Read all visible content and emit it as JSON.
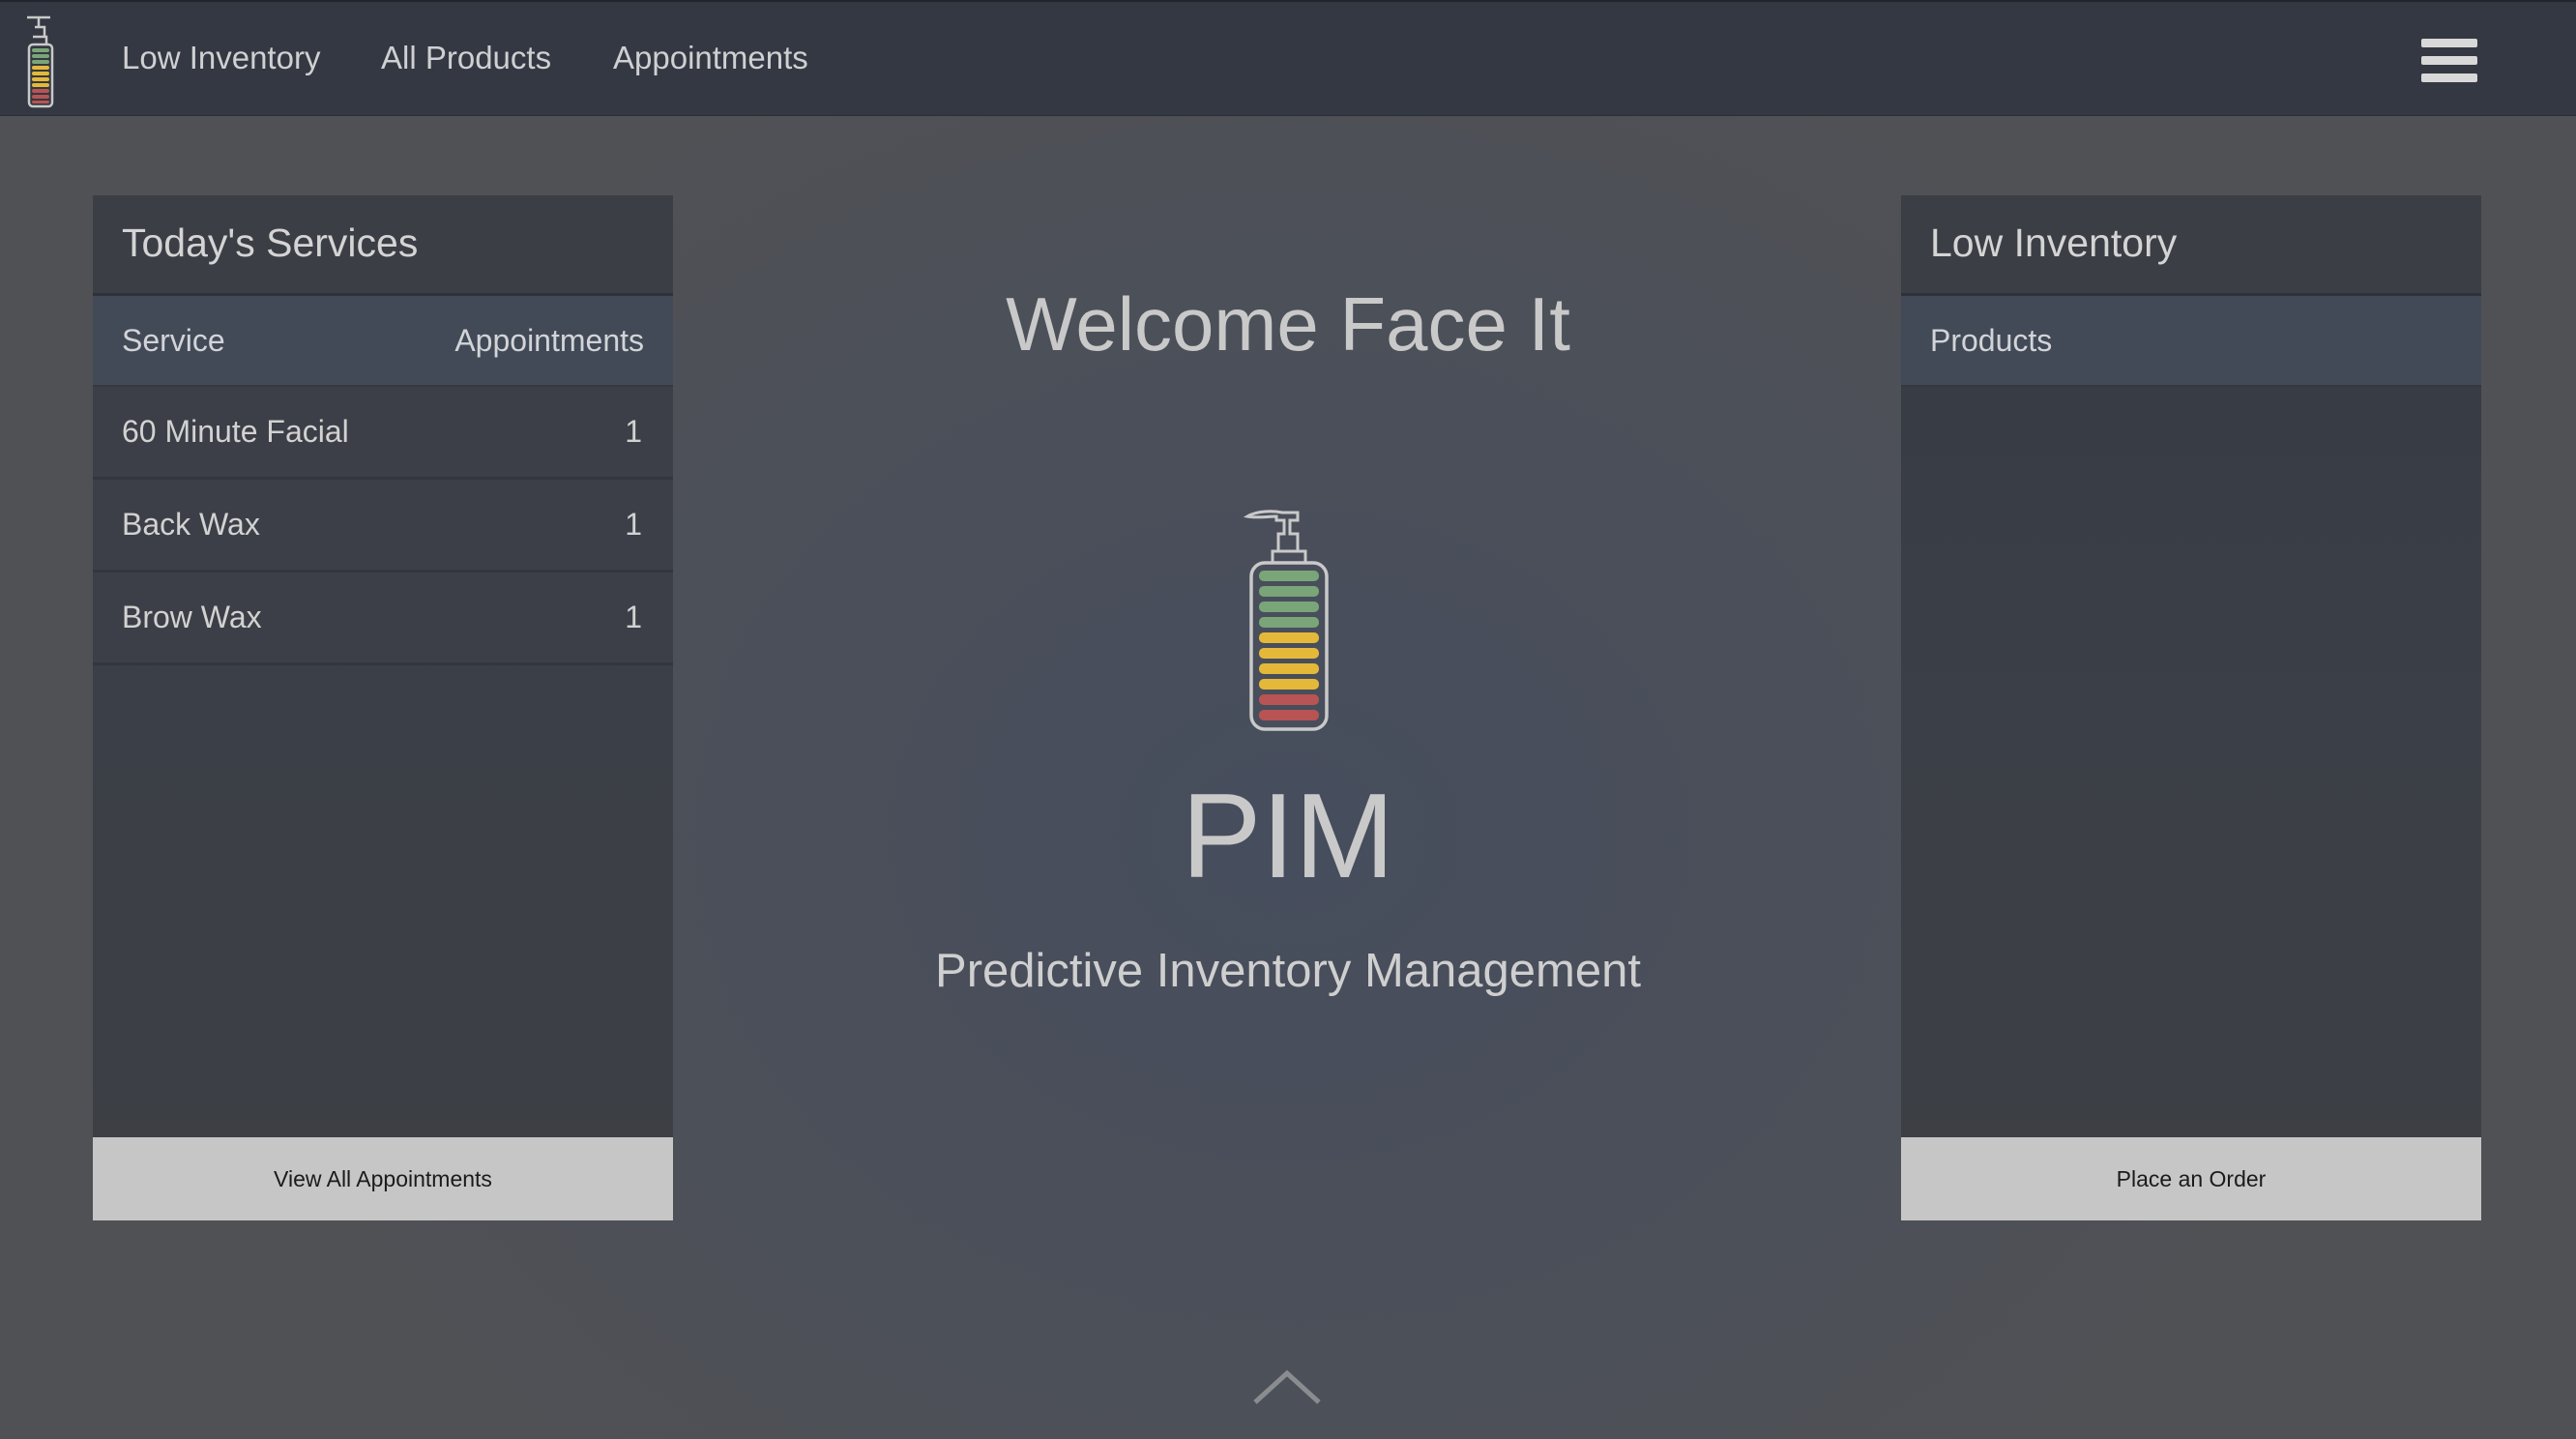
{
  "nav": {
    "links": [
      "Low Inventory",
      "All Products",
      "Appointments"
    ]
  },
  "services_panel": {
    "title": "Today's Services",
    "columns": [
      "Service",
      "Appointments"
    ],
    "rows": [
      {
        "service": "60 Minute Facial",
        "count": "1"
      },
      {
        "service": "Back Wax",
        "count": "1"
      },
      {
        "service": "Brow Wax",
        "count": "1"
      }
    ],
    "button": "View All Appointments"
  },
  "center": {
    "welcome": "Welcome Face It",
    "brand": "PIM",
    "tagline": "Predictive Inventory Management"
  },
  "inventory_panel": {
    "title": "Low Inventory",
    "column": "Products",
    "button": "Place an Order"
  },
  "icons": {
    "logo": "pump-bottle-icon",
    "menu": "hamburger-menu-icon",
    "scroll": "chevron-up-icon"
  },
  "colors": {
    "green_level": "#7aa578",
    "yellow_level": "#e4b93a",
    "red_level": "#b85454",
    "button_bg": "#c6c6c6"
  }
}
